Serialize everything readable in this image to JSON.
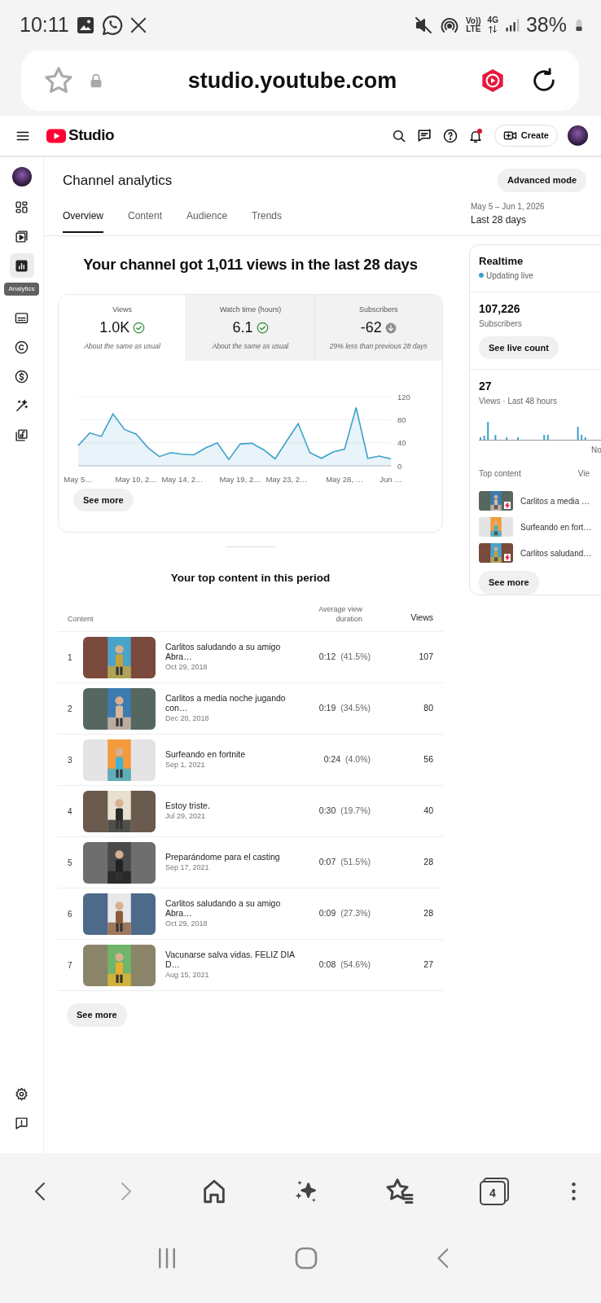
{
  "status_bar": {
    "time": "10:11",
    "network": [
      "Vo)) LTE",
      "4G"
    ],
    "battery": "38%"
  },
  "browser": {
    "url": "studio.youtube.com"
  },
  "header": {
    "logo": "Studio",
    "create": "Create",
    "notification_dot": true
  },
  "sidebar": {
    "items": [
      {
        "selected": false
      },
      {
        "selected": false
      },
      {
        "selected": true
      },
      {
        "selected": false
      },
      {
        "selected": false
      },
      {
        "selected": false
      },
      {
        "selected": false
      },
      {
        "selected": false
      }
    ],
    "tooltip": "Analytics"
  },
  "page": {
    "title": "Channel analytics",
    "advanced_button": "Advanced mode",
    "date_range": "May 5 – Jun 1, 2026",
    "period": "Last 28 days",
    "tabs": [
      {
        "label": "Overview",
        "selected": true
      },
      {
        "label": "Content",
        "selected": false
      },
      {
        "label": "Audience",
        "selected": false
      },
      {
        "label": "Trends",
        "selected": false
      }
    ]
  },
  "summary": {
    "headline": "Your channel got 1,011 views in the last 28 days",
    "metrics": [
      {
        "label": "Views",
        "value": "1.0K",
        "decreased": false,
        "note": "About the same as usual",
        "selected": true
      },
      {
        "label": "Watch time (hours)",
        "value": "6.1",
        "decreased": false,
        "note": "About the same as usual",
        "selected": false
      },
      {
        "label": "Subscribers",
        "value": "-62",
        "decreased": true,
        "note": "29% less than previous 28 days",
        "selected": false
      }
    ],
    "chart_data": {
      "type": "area",
      "categories": [
        "May 5…",
        null,
        null,
        null,
        null,
        "May 10, 2…",
        null,
        null,
        null,
        "May 14, 2…",
        null,
        null,
        null,
        null,
        "May 19, 2…",
        null,
        null,
        null,
        "May 23, 2…",
        null,
        null,
        null,
        null,
        "May 28, …",
        null,
        null,
        null,
        "Jun …"
      ],
      "series": [
        {
          "color": "#3ea1cb",
          "values": [
            35,
            57,
            51,
            90,
            63,
            55,
            32,
            16,
            23,
            20,
            19,
            31,
            40,
            11,
            38,
            39,
            28,
            12,
            43,
            73,
            23,
            13,
            24,
            29,
            101,
            13,
            17,
            12
          ]
        }
      ],
      "ylim": [
        0,
        120
      ],
      "yticks": [
        0,
        40,
        80,
        120
      ]
    },
    "see_more": "See more"
  },
  "top_content": {
    "title": "Your top content in this period",
    "columns": [
      "Content",
      "Average view duration",
      "Views"
    ],
    "rows": [
      {
        "rank": "1",
        "title": "Carlitos saludando a su amigo Abra…",
        "date": "Oct 29, 2018",
        "duration": "0:12",
        "percent": "(41.5%)",
        "views": "107"
      },
      {
        "rank": "2",
        "title": "Carlitos a media noche jugando con…",
        "date": "Dec 20, 2018",
        "duration": "0:19",
        "percent": "(34.5%)",
        "views": "80"
      },
      {
        "rank": "3",
        "title": "Surfeando en fortnite",
        "date": "Sep 1, 2021",
        "duration": "0:24",
        "percent": "(4.0%)",
        "views": "56"
      },
      {
        "rank": "4",
        "title": "Estoy triste.",
        "date": "Jul 29, 2021",
        "duration": "0:30",
        "percent": "(19.7%)",
        "views": "40"
      },
      {
        "rank": "5",
        "title": "Preparándome para el casting",
        "date": "Sep 17, 2021",
        "duration": "0:07",
        "percent": "(51.5%)",
        "views": "28"
      },
      {
        "rank": "6",
        "title": "Carlitos saludando a su amigo Abra…",
        "date": "Oct 29, 2018",
        "duration": "0:09",
        "percent": "(27.3%)",
        "views": "28"
      },
      {
        "rank": "7",
        "title": "Vacunarse salva vidas. FELIZ DIA D…",
        "date": "Aug 15, 2021",
        "duration": "0:08",
        "percent": "(54.6%)",
        "views": "27"
      }
    ],
    "see_more": "See more"
  },
  "realtime": {
    "title": "Realtime",
    "live": true,
    "status": "Updating live",
    "subscribers": "107,226",
    "subscribers_label": "Subscribers",
    "live_count_button": "See live count",
    "views": "27",
    "views_label": "Views · Last 48 hours",
    "chart_axis_label": "No",
    "top_content_label": "Top content",
    "views_column": "Vie",
    "items": [
      {
        "title": "Carlitos a media …",
        "shorts": true
      },
      {
        "title": "Surfeando en fort…",
        "shorts": false
      },
      {
        "title": "Carlitos saludand…",
        "shorts": true
      }
    ],
    "see_more": "See more"
  },
  "browser_nav": {
    "forward_disabled": true,
    "tab_count": "4"
  }
}
